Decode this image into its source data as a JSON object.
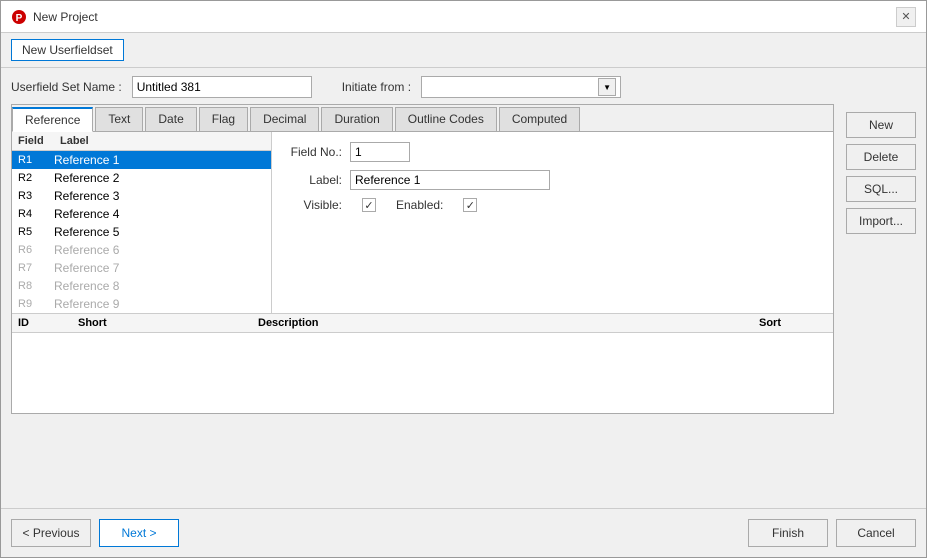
{
  "window": {
    "title": "New Project"
  },
  "toolbar": {
    "new_userfieldset_label": "New Userfieldset"
  },
  "header": {
    "userfield_set_name_label": "Userfield Set Name :",
    "userfield_set_name_value": "Untitled 381",
    "initiate_from_label": "Initiate from :"
  },
  "tabs": [
    {
      "id": "reference",
      "label": "Reference",
      "active": true
    },
    {
      "id": "text",
      "label": "Text",
      "active": false
    },
    {
      "id": "date",
      "label": "Date",
      "active": false
    },
    {
      "id": "flag",
      "label": "Flag",
      "active": false
    },
    {
      "id": "decimal",
      "label": "Decimal",
      "active": false
    },
    {
      "id": "duration",
      "label": "Duration",
      "active": false
    },
    {
      "id": "outline_codes",
      "label": "Outline Codes",
      "active": false
    },
    {
      "id": "computed",
      "label": "Computed",
      "active": false
    }
  ],
  "list": {
    "headers": [
      "Field",
      "Label"
    ],
    "items": [
      {
        "field": "R1",
        "label": "Reference 1",
        "selected": true,
        "enabled": true
      },
      {
        "field": "R2",
        "label": "Reference 2",
        "selected": false,
        "enabled": true
      },
      {
        "field": "R3",
        "label": "Reference 3",
        "selected": false,
        "enabled": true
      },
      {
        "field": "R4",
        "label": "Reference 4",
        "selected": false,
        "enabled": true
      },
      {
        "field": "R5",
        "label": "Reference 5",
        "selected": false,
        "enabled": true
      },
      {
        "field": "R6",
        "label": "Reference 6",
        "selected": false,
        "enabled": false
      },
      {
        "field": "R7",
        "label": "Reference 7",
        "selected": false,
        "enabled": false
      },
      {
        "field": "R8",
        "label": "Reference 8",
        "selected": false,
        "enabled": false
      },
      {
        "field": "R9",
        "label": "Reference 9",
        "selected": false,
        "enabled": false
      }
    ]
  },
  "details": {
    "field_no_label": "Field No.:",
    "field_no_value": "1",
    "label_label": "Label:",
    "label_value": "Reference 1",
    "visible_label": "Visible:",
    "visible_checked": true,
    "enabled_label": "Enabled:",
    "enabled_checked": true
  },
  "grid": {
    "columns": [
      "ID",
      "Short",
      "Description",
      "Sort"
    ]
  },
  "buttons": {
    "new_label": "New",
    "delete_label": "Delete",
    "sql_label": "SQL...",
    "import_label": "Import..."
  },
  "footer": {
    "previous_label": "< Previous",
    "next_label": "Next >",
    "finish_label": "Finish",
    "cancel_label": "Cancel"
  }
}
